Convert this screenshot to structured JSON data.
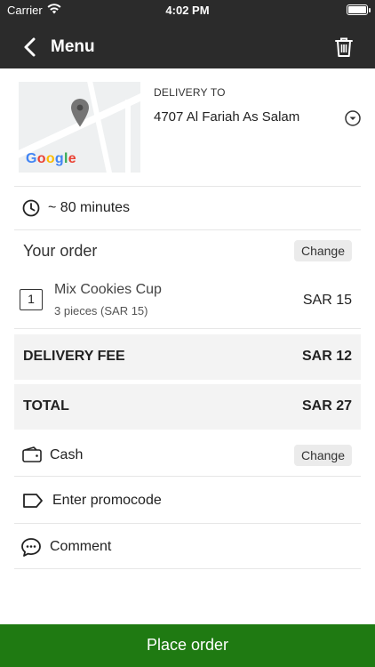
{
  "status_bar": {
    "carrier": "Carrier",
    "time": "4:02 PM"
  },
  "nav": {
    "title": "Menu",
    "back_icon": "chevron-left-icon",
    "trash_icon": "trash-icon"
  },
  "delivery": {
    "label": "DELIVERY TO",
    "address": "4707 Al Fariah As Salam",
    "map_logo": "Google"
  },
  "eta": {
    "text": "~ 80 minutes",
    "icon": "clock-icon"
  },
  "order": {
    "heading": "Your order",
    "change_label": "Change",
    "items": [
      {
        "qty": "1",
        "name": "Mix Cookies Cup",
        "detail": "3 pieces (SAR 15)",
        "price": "SAR 15"
      }
    ]
  },
  "summary": {
    "delivery_fee_label": "DELIVERY FEE",
    "delivery_fee_value": "SAR 12",
    "total_label": "TOTAL",
    "total_value": "SAR 27"
  },
  "payment": {
    "method": "Cash",
    "change_label": "Change",
    "icon": "wallet-icon"
  },
  "promo": {
    "placeholder": "Enter promocode",
    "icon": "tag-icon"
  },
  "comment": {
    "label": "Comment",
    "icon": "chat-bubble-icon"
  },
  "cta": {
    "label": "Place order",
    "color": "#1f7a12"
  },
  "colors": {
    "topbar": "#2b2b2b",
    "band": "#f3f3f3",
    "chip": "#ebebeb"
  }
}
